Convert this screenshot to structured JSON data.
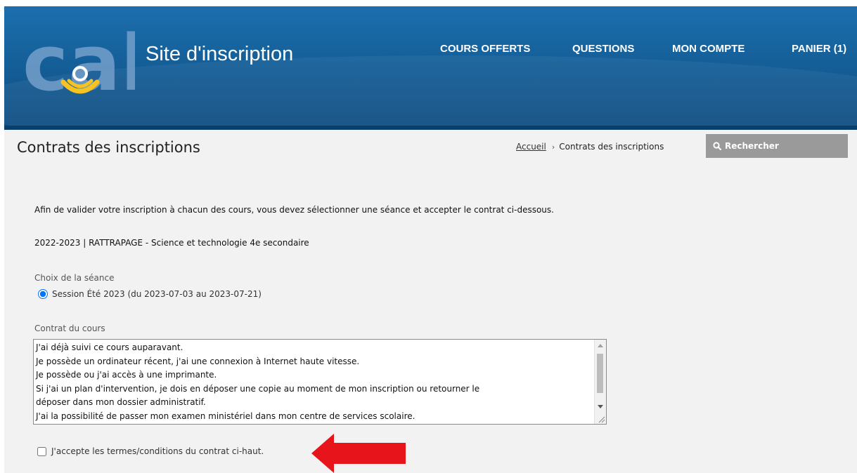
{
  "header": {
    "logo_text": "cal",
    "site_title": "Site d'inscription",
    "nav": [
      "COURS OFFERTS",
      "QUESTIONS",
      "MON COMPTE",
      "PANIER (1)"
    ]
  },
  "titlebar": {
    "page_title": "Contrats des inscriptions",
    "breadcrumb_home": "Accueil",
    "breadcrumb_sep": "›",
    "breadcrumb_current": "Contrats des inscriptions",
    "search_label": "Rechercher"
  },
  "content": {
    "intro": "Afin de valider votre inscription à chacun des cours, vous devez sélectionner une séance et accepter le contrat ci-dessous.",
    "course_name": "2022-2023 | RATTRAPAGE - Science et technologie 4e secondaire",
    "session_label": "Choix de la séance",
    "session_option": "Session Été 2023 (du 2023-07-03 au 2023-07-21)",
    "contract_label": "Contrat du cours",
    "contract_lines": [
      "J'ai déjà suivi ce cours auparavant.",
      "Je possède un ordinateur récent, j'ai une connexion à Internet haute vitesse.",
      "Je possède ou j'ai accès à une imprimante.",
      "Si j'ai un plan d'intervention, je dois en déposer une copie au moment de mon inscription ou retourner le",
      "déposer dans mon dossier administratif.",
      "J'ai la possibilité de passer mon examen ministériel dans mon centre de services scolaire."
    ],
    "accept_label": "J'accepte les termes/conditions du contrat ci-haut."
  },
  "colors": {
    "header_blue": "#155f99",
    "logo_yellow": "#f6c321",
    "arrow_red": "#e8141b",
    "search_gray": "#9a9a9a"
  },
  "icons": [
    "search-icon",
    "arrow-pointer-icon"
  ]
}
